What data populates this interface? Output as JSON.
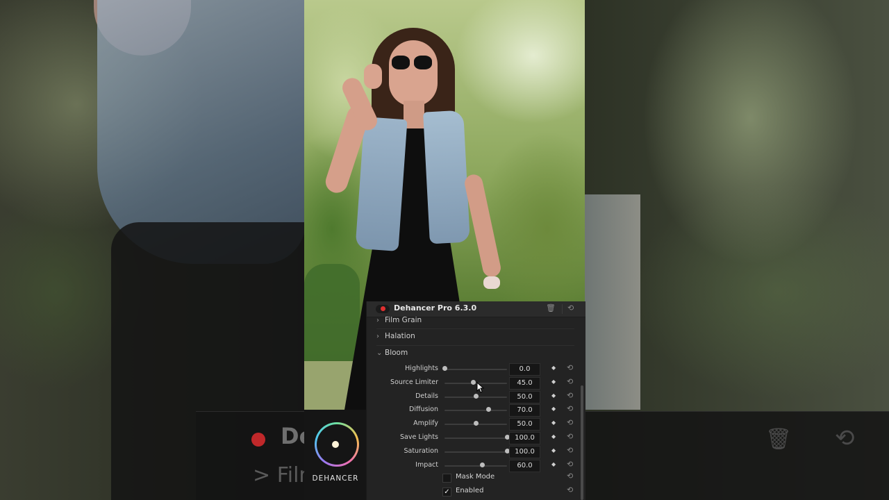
{
  "background_panel": {
    "title_fragment": "De",
    "sub_fragment": "Film",
    "trash_icon": "trash-icon",
    "reset_icon": "reset-icon"
  },
  "logo": {
    "brand": "DEHANCER"
  },
  "plugin": {
    "title": "Dehancer Pro 6.3.0",
    "record_color": "#e03030",
    "sections": [
      {
        "label": "Film Grain",
        "expanded": false
      },
      {
        "label": "Halation",
        "expanded": false
      },
      {
        "label": "Bloom",
        "expanded": true
      }
    ],
    "params": [
      {
        "label": "Highlights",
        "value": "0.0",
        "fraction": 0.0
      },
      {
        "label": "Source Limiter",
        "value": "45.0",
        "fraction": 0.45
      },
      {
        "label": "Details",
        "value": "50.0",
        "fraction": 0.5
      },
      {
        "label": "Diffusion",
        "value": "70.0",
        "fraction": 0.7
      },
      {
        "label": "Amplify",
        "value": "50.0",
        "fraction": 0.5
      },
      {
        "label": "Save Lights",
        "value": "100.0",
        "fraction": 1.0
      },
      {
        "label": "Saturation",
        "value": "100.0",
        "fraction": 1.0
      },
      {
        "label": "Impact",
        "value": "60.0",
        "fraction": 0.6
      }
    ],
    "checkboxes": [
      {
        "label": "Mask Mode",
        "checked": false
      },
      {
        "label": "Enabled",
        "checked": true
      }
    ]
  }
}
